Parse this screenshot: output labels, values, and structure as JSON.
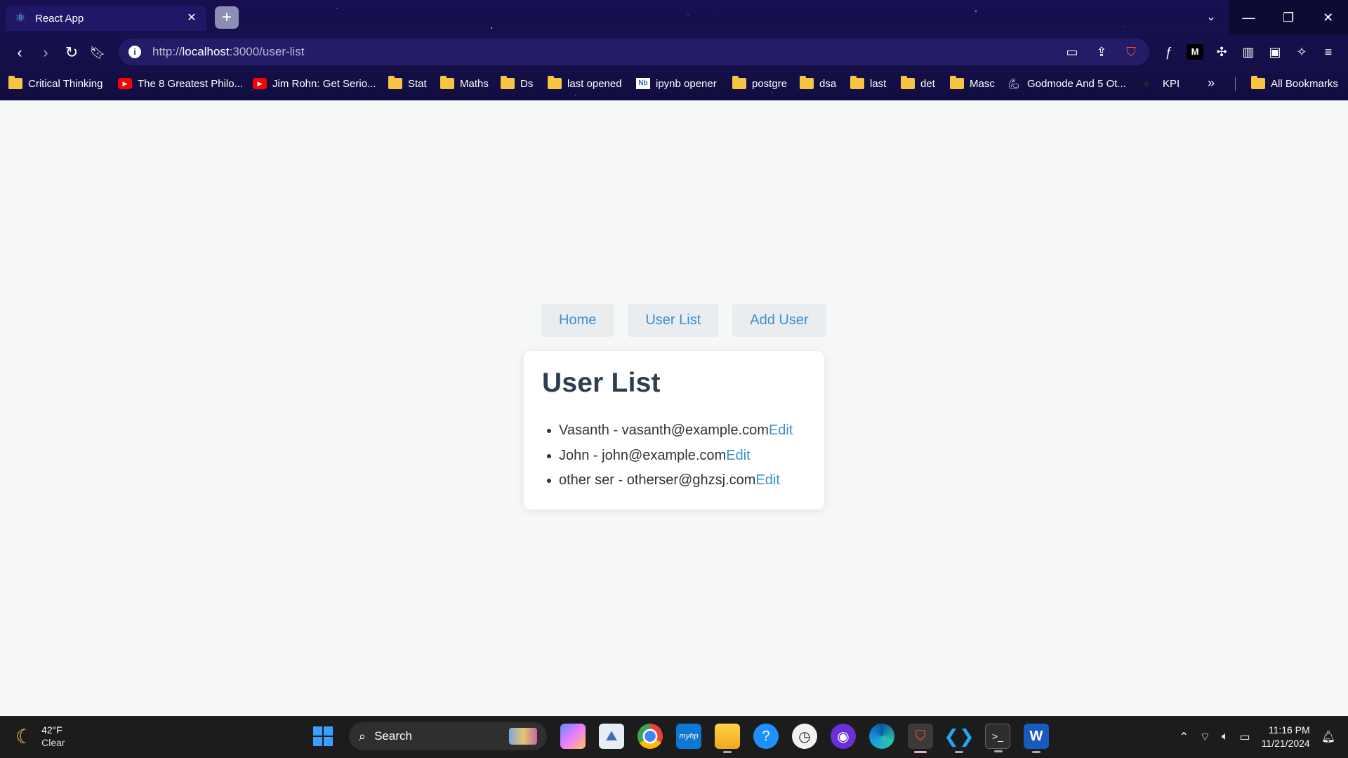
{
  "browser": {
    "tab_title": "React App",
    "url_scheme": "http://",
    "url_host": "localhost",
    "url_rest": ":3000/user-list",
    "bookmarks": [
      {
        "label": "Critical Thinking",
        "icon": "folder-icon"
      },
      {
        "label": "The 8 Greatest Philo...",
        "icon": "youtube-icon"
      },
      {
        "label": "Jim Rohn: Get Serio...",
        "icon": "youtube-icon"
      },
      {
        "label": "Stat",
        "icon": "folder-icon"
      },
      {
        "label": "Maths",
        "icon": "folder-icon"
      },
      {
        "label": "Ds",
        "icon": "folder-icon"
      },
      {
        "label": "last opened",
        "icon": "folder-icon"
      },
      {
        "label": "ipynb opener",
        "icon": "notebook-icon"
      },
      {
        "label": "postgre",
        "icon": "folder-icon"
      },
      {
        "label": "dsa",
        "icon": "folder-icon"
      },
      {
        "label": "last",
        "icon": "folder-icon"
      },
      {
        "label": "det",
        "icon": "folder-icon"
      },
      {
        "label": "Masc",
        "icon": "folder-icon"
      },
      {
        "label": "Godmode And 5 Ot...",
        "icon": "arm-icon"
      },
      {
        "label": "KPI",
        "icon": "github-icon"
      }
    ],
    "all_bookmarks": "All Bookmarks",
    "accent_brave": "#fb542b"
  },
  "app": {
    "nav": [
      "Home",
      "User List",
      "Add User"
    ],
    "heading": "User List",
    "users": [
      {
        "text": "Vasanth - vasanth@example.com",
        "action": "Edit"
      },
      {
        "text": "John - john@example.com",
        "action": "Edit"
      },
      {
        "text": "other ser - otherser@ghzsj.com",
        "action": "Edit"
      }
    ],
    "link_color": "#3a8fd0",
    "heading_color": "#2c3e50"
  },
  "taskbar": {
    "temperature": "42°F",
    "condition": "Clear",
    "search_label": "Search",
    "time": "11:16 PM",
    "date": "11/21/2024"
  }
}
